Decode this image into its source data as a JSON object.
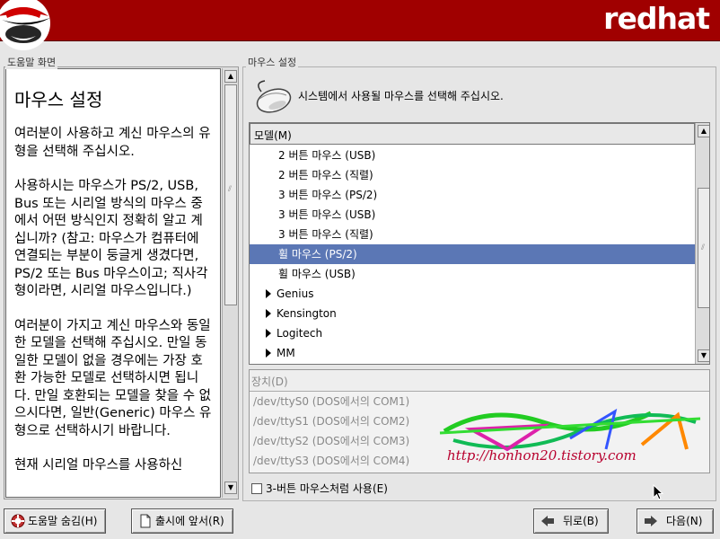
{
  "header": {
    "brand": "redhat"
  },
  "help_panel": {
    "frame_label": "도움말 화면",
    "title": "마우스 설정",
    "paragraphs": [
      "여러분이 사용하고 계신 마우스의 유형을 선택해 주십시오.",
      "사용하시는 마우스가 PS/2, USB, Bus 또는 시리얼 방식의 마우스 중에서 어떤 방식인지 정확히 알고 계십니까? (참고: 마우스가 컴퓨터에 연결되는 부분이 둥글게 생겼다면, PS/2 또는 Bus 마우스이고; 직사각형이라면, 시리얼 마우스입니다.)",
      "여러분이 가지고 계신 마우스와 동일한 모델을 선택해 주십시오. 만일 동일한 모델이 없을 경우에는 가장 호환 가능한 모델로 선택하시면 됩니다. 만일 호환되는 모델을 찾을 수 없으시다면, 일반(Generic) 마우스 유형으로 선택하시기 바랍니다.",
      "현재 시리얼 마우스를 사용하신"
    ]
  },
  "mouse_panel": {
    "frame_label": "마우스 설정",
    "instruction": "시스템에서 사용될 마우스를 선택해 주십시오.",
    "model_header": "모델(M)",
    "models": [
      {
        "label": "2 버튼 마우스 (USB)",
        "type": "item",
        "selected": false
      },
      {
        "label": "2 버튼 마우스 (직렬)",
        "type": "item",
        "selected": false
      },
      {
        "label": "3 버튼 마우스 (PS/2)",
        "type": "item",
        "selected": false
      },
      {
        "label": "3 버튼 마우스 (USB)",
        "type": "item",
        "selected": false
      },
      {
        "label": "3 버튼 마우스 (직렬)",
        "type": "item",
        "selected": false
      },
      {
        "label": "휠 마우스 (PS/2)",
        "type": "item",
        "selected": true
      },
      {
        "label": "휠 마우스 (USB)",
        "type": "item",
        "selected": false
      },
      {
        "label": "Genius",
        "type": "group",
        "selected": false
      },
      {
        "label": "Kensington",
        "type": "group",
        "selected": false
      },
      {
        "label": "Logitech",
        "type": "group",
        "selected": false
      },
      {
        "label": "MM",
        "type": "group",
        "selected": false
      }
    ],
    "device_header": "장치(D)",
    "devices": [
      "/dev/ttyS0 (DOS에서의 COM1)",
      "/dev/ttyS1 (DOS에서의 COM2)",
      "/dev/ttyS2 (DOS에서의 COM3)",
      "/dev/ttyS3 (DOS에서의 COM4)"
    ],
    "watermark_text": "http://honhon20.tistory.com",
    "emulate_3_button_label": "3-버튼 마우스처럼 사용(E)",
    "emulate_3_button_checked": false
  },
  "buttons": {
    "hide_help": "도움말 숨김(H)",
    "release_notes": "출시에 앞서(R)",
    "back": "뒤로(B)",
    "next": "다음(N)"
  },
  "colors": {
    "header": "#a00000",
    "selection": "#5b77b5"
  },
  "icons": [
    "shadowman-logo",
    "mouse-icon",
    "help-icon",
    "notes-icon",
    "back-arrow-icon",
    "next-arrow-icon"
  ]
}
